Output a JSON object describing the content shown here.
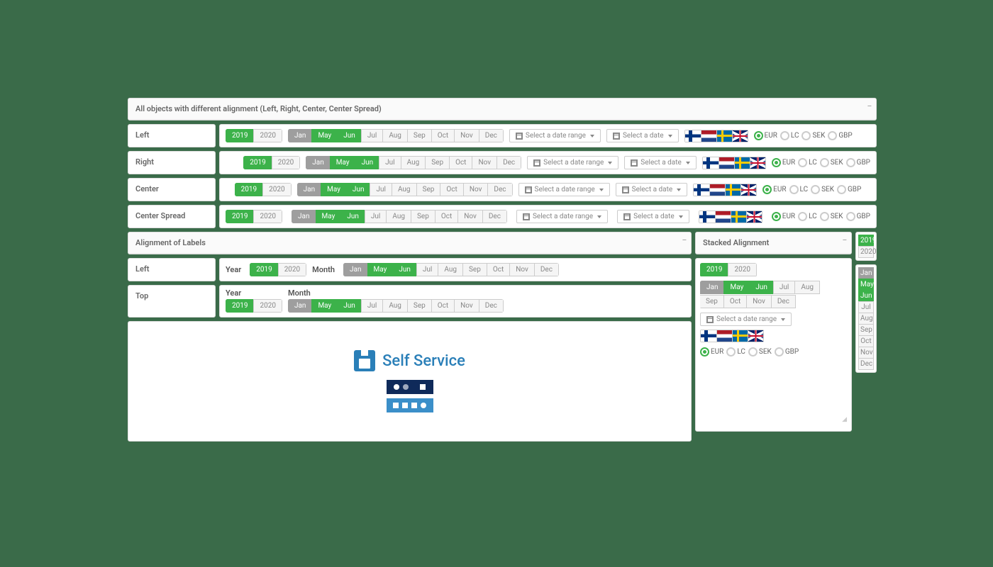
{
  "header": {
    "title": "All objects with different alignment (Left, Right, Center, Center Spread)"
  },
  "rows": {
    "left": "Left",
    "right": "Right",
    "center": "Center",
    "centerSpread": "Center Spread"
  },
  "years": [
    "2019",
    "2020"
  ],
  "year_sel": 0,
  "months": [
    "Jan",
    "May",
    "Jun",
    "Jul",
    "Aug",
    "Sep",
    "Oct",
    "Nov",
    "Dec"
  ],
  "month_state": [
    "grey",
    "green",
    "green",
    "off",
    "off",
    "off",
    "off",
    "off",
    "off"
  ],
  "dateRange": "Select a date range",
  "date": "Select a date",
  "flags": [
    "fi",
    "nl",
    "se",
    "gb"
  ],
  "currencies": [
    "EUR",
    "LC",
    "SEK",
    "GBP"
  ],
  "currency_sel": 0,
  "alignLabels": {
    "title": "Alignment of Labels",
    "left": "Left",
    "top": "Top",
    "year": "Year",
    "month": "Month"
  },
  "stacked": {
    "title": "Stacked Alignment",
    "months_long": [
      "Jan",
      "May",
      "Jun",
      "Jul",
      "Aug",
      "Sep",
      "Oct",
      "Nov",
      "Dec"
    ]
  },
  "selfService": "Self Service"
}
